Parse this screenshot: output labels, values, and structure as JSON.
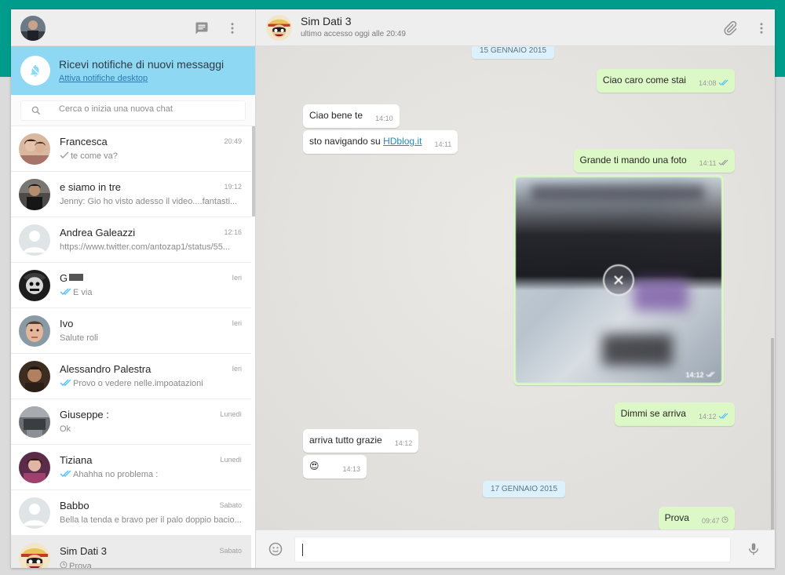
{
  "colors": {
    "accent": "#009c8b",
    "notif_bg": "#8fd8f4",
    "out_bubble": "#dcf8c6",
    "tick_blue": "#4fc3f7"
  },
  "left": {
    "notification": {
      "title": "Ricevi notifiche di nuovi messaggi",
      "link": "Attiva notifiche desktop"
    },
    "search": {
      "placeholder": "Cerca o inizia una nuova chat"
    },
    "chats": [
      {
        "name": "Francesca",
        "time": "20:49",
        "last": "te come va?",
        "tick": "grey",
        "avatar": "photo-woman"
      },
      {
        "name": "e siamo in tre",
        "time": "19:12",
        "last": "Jenny: Gio ho visto adesso il video....fantasti...",
        "tick": "none",
        "avatar": "photo-man"
      },
      {
        "name": "Andrea Galeazzi",
        "time": "12:16",
        "last": "https://www.twitter.com/antozap1/status/55...",
        "tick": "none",
        "avatar": "default"
      },
      {
        "name": "G",
        "time": "Ieri",
        "last": "E via",
        "tick": "blue",
        "avatar": "photo-dark"
      },
      {
        "name": "Ivo",
        "time": "Ieri",
        "last": "Salute roli",
        "tick": "none",
        "avatar": "photo-face"
      },
      {
        "name": "Alessandro Palestra",
        "time": "Ieri",
        "last": "Provo o vedere nelle.impoatazioni",
        "tick": "blue",
        "avatar": "photo-man2"
      },
      {
        "name": "Giuseppe :",
        "time": "Lunedì",
        "last": "Ok",
        "tick": "none",
        "avatar": "photo-grey"
      },
      {
        "name": "Tiziana",
        "time": "Lunedì",
        "last": "Ahahha no problema :",
        "tick": "blue",
        "avatar": "photo-purple"
      },
      {
        "name": "Babbo",
        "time": "Sabato",
        "last": "Bella la tenda e bravo per il palo doppio bacio...",
        "tick": "none",
        "avatar": "default"
      },
      {
        "name": "Sim Dati 3",
        "time": "Sabato",
        "last": "Prova",
        "tick": "clock",
        "avatar": "luffy"
      }
    ]
  },
  "right": {
    "contact": {
      "name": "Sim Dati 3",
      "status": "ultimo accesso oggi alle 20:49"
    },
    "days": [
      "15 GENNAIO 2015",
      "17 GENNAIO 2015"
    ],
    "messages": [
      {
        "text": "Ciao caro come stai",
        "time": "14:08"
      },
      {
        "text": "Ciao bene te",
        "time": "14:10"
      },
      {
        "text_prefix": "sto navigando su ",
        "link": "HDblog.it",
        "time": "14:11"
      },
      {
        "text": "Grande ti mando una foto",
        "time": "14:11"
      },
      {
        "photo_time": "14:12"
      },
      {
        "text": "Dimmi se arriva",
        "time": "14:12"
      },
      {
        "text": "arriva tutto grazie",
        "time": "14:12"
      },
      {
        "emoji": "😍",
        "time": "14:13"
      },
      {
        "text": "Prova",
        "time": "09:47"
      }
    ]
  }
}
